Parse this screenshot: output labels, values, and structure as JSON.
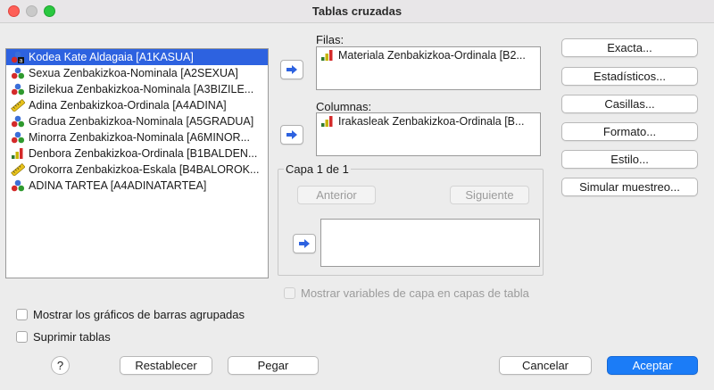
{
  "window": {
    "title": "Tablas cruzadas"
  },
  "variables": [
    {
      "label": "Kodea Kate Aldagaia [A1KASUA]",
      "icon": "string-nominal-icon",
      "selected": true
    },
    {
      "label": "Sexua Zenbakizkoa-Nominala [A2SEXUA]",
      "icon": "nominal-icon"
    },
    {
      "label": "Bizilekua Zenbakizkoa-Nominala [A3BIZILE...",
      "icon": "nominal-icon"
    },
    {
      "label": "Adina Zenbakizkoa-Ordinala [A4ADINA]",
      "icon": "scale-ruler-icon"
    },
    {
      "label": "Gradua Zenbakizkoa-Nominala [A5GRADUA]",
      "icon": "nominal-icon"
    },
    {
      "label": "Minorra Zenbakizkoa-Nominala [A6MINOR...",
      "icon": "nominal-icon"
    },
    {
      "label": "Denbora Zenbakizkoa-Ordinala [B1BALDEN...",
      "icon": "ordinal-bar-icon"
    },
    {
      "label": "Orokorra Zenbakizkoa-Eskala [B4BALOROK...",
      "icon": "scale-ruler-icon"
    },
    {
      "label": "ADINA TARTEA [A4ADINATARTEA]",
      "icon": "nominal-icon"
    }
  ],
  "rows": {
    "label": "Filas:",
    "items": [
      "Materiala Zenbakizkoa-Ordinala [B2..."
    ]
  },
  "columns": {
    "label": "Columnas:",
    "items": [
      "Irakasleak Zenbakizkoa-Ordinala [B..."
    ]
  },
  "layer": {
    "title": "Capa 1 de 1",
    "prev_label": "Anterior",
    "next_label": "Siguiente"
  },
  "side_buttons": {
    "exact": "Exacta...",
    "statistics": "Estadísticos...",
    "cells": "Casillas...",
    "format": "Formato...",
    "style": "Estilo...",
    "bootstrap": "Simular muestreo..."
  },
  "options": {
    "show_layer_vars": "Mostrar variables de capa en capas de tabla",
    "clustered_bars": "Mostrar los gráficos de barras agrupadas",
    "suppress_tables": "Suprimir tablas"
  },
  "footer": {
    "help": "?",
    "reset": "Restablecer",
    "paste": "Pegar",
    "cancel": "Cancelar",
    "accept": "Aceptar"
  },
  "colors": {
    "selection": "#2d62e0",
    "primary": "#1b7cf7"
  }
}
